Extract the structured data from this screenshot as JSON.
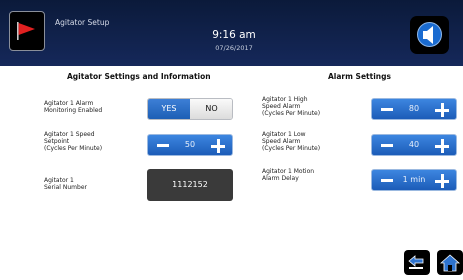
{
  "header": {
    "title": "Agitator Setup",
    "time": "9:16 am",
    "date": "07/26/2017",
    "flag_icon_color": "#e02020",
    "speaker_icon_color": "#1a6bd0"
  },
  "left_section": {
    "heading": "Agitator Settings and Information",
    "alarm_monitoring": {
      "label": [
        "Agitator 1 Alarm",
        "Monitoring Enabled"
      ],
      "yes_label": "YES",
      "no_label": "NO",
      "selected": "YES"
    },
    "speed_setpoint": {
      "label": [
        "Agitator 1 Speed",
        "Setpoint",
        "(Cycles Per Minute)"
      ],
      "value": "50"
    },
    "serial": {
      "label": [
        "Agitator 1",
        "Serial Number"
      ],
      "value": "1112152"
    }
  },
  "right_section": {
    "heading": "Alarm Settings",
    "high_speed": {
      "label": [
        "Agitator 1 High",
        "Speed Alarm",
        "(Cycles Per Minute)"
      ],
      "value": "80"
    },
    "low_speed": {
      "label": [
        "Agitator 1 Low",
        "Speed Alarm",
        "(Cycles Per Minute)"
      ],
      "value": "40"
    },
    "motion_delay": {
      "label": [
        "Agitator 1 Motion",
        "Alarm Delay"
      ],
      "value": "1 min"
    }
  },
  "footer": {
    "back_icon": "back-arrow-icon",
    "home_icon": "home-icon"
  }
}
